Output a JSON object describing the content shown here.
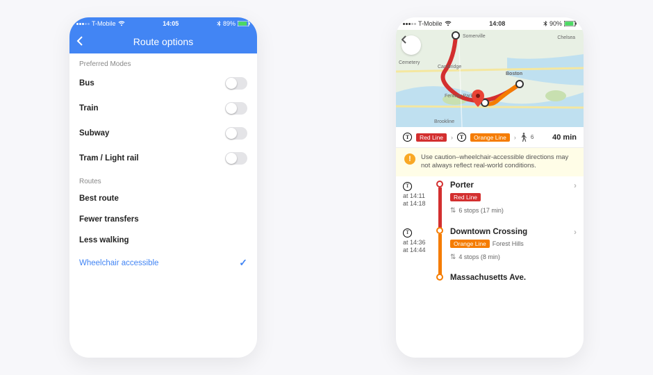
{
  "left": {
    "status": {
      "carrier": "T-Mobile",
      "time": "14:05",
      "battery": "89%"
    },
    "header": {
      "title": "Route options"
    },
    "preferred_label": "Preferred Modes",
    "modes": [
      {
        "label": "Bus"
      },
      {
        "label": "Train"
      },
      {
        "label": "Subway"
      },
      {
        "label": "Tram / Light rail"
      }
    ],
    "routes_label": "Routes",
    "routes": [
      {
        "label": "Best route"
      },
      {
        "label": "Fewer transfers"
      },
      {
        "label": "Less walking"
      },
      {
        "label": "Wheelchair accessible",
        "selected": true
      }
    ]
  },
  "right": {
    "status": {
      "carrier": "T-Mobile",
      "time": "14:08",
      "battery": "90%"
    },
    "map_labels": {
      "somerville": "Somerville",
      "cambridge": "Cambridge",
      "boston": "Boston",
      "chelsea": "Chelsea",
      "fenway": "Fenway Park",
      "brookline": "Brookline",
      "cemetery": "Cemetery"
    },
    "summary": {
      "lines": [
        "Red Line",
        "Orange Line"
      ],
      "walk_min": "6",
      "duration": "40 min"
    },
    "warning": "Use caution–wheelchair-accessible directions may not always reflect real-world conditions.",
    "steps": [
      {
        "time1": "at 14:11",
        "time2": "at 14:18",
        "station": "Porter",
        "line_name": "Red Line",
        "line_color": "#d32f2f",
        "stops": "6 stops (17 min)"
      },
      {
        "time1": "at 14:36",
        "time2": "at 14:44",
        "station": "Downtown Crossing",
        "line_name": "Orange Line",
        "line_dest": "Forest Hills",
        "line_color": "#f57c00",
        "stops": "4 stops (8 min)"
      },
      {
        "station": "Massachusetts Ave.",
        "line_color": "#f57c00"
      }
    ]
  }
}
